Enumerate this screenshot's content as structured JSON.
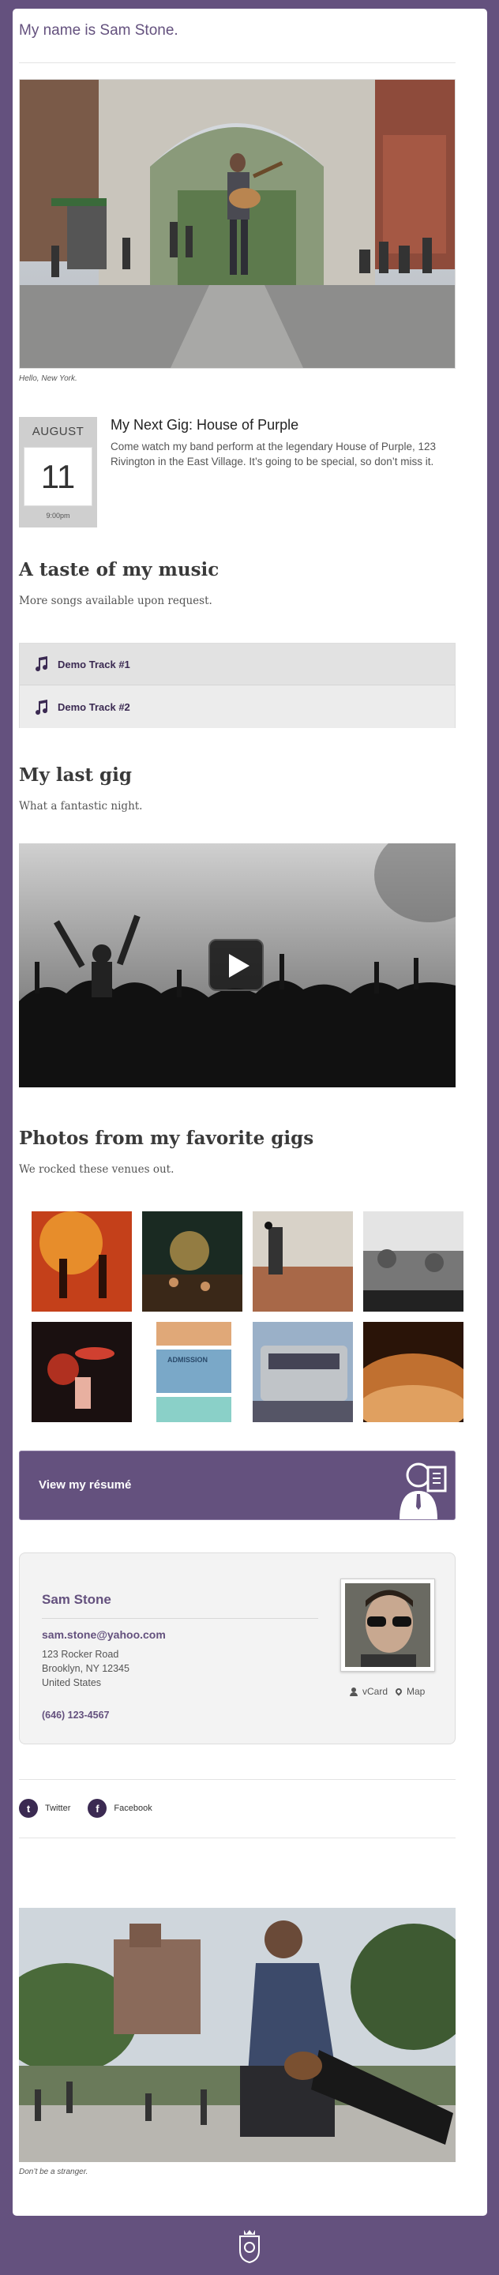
{
  "site_title": "My name is Sam Stone.",
  "hero_caption": "Hello, New York.",
  "gig": {
    "month": "AUGUST",
    "day": "11",
    "time": "9:00pm",
    "title": "My Next Gig: House of Purple",
    "description": "Come watch my band perform at the legendary House of Purple, 123 Rivington in the East Village. It’s going to be special, so don’t miss it."
  },
  "music": {
    "heading": "A taste of my music",
    "lede": "More songs available upon request.",
    "tracks": [
      {
        "label": "Demo Track #1",
        "icon": "music-note-icon"
      },
      {
        "label": "Demo Track #2",
        "icon": "music-note-icon"
      }
    ]
  },
  "last_gig": {
    "heading": "My last gig",
    "lede": "What a fantastic night."
  },
  "photos": {
    "heading": "Photos from my favorite gigs",
    "lede": "We rocked these venues out.",
    "ticket_text": "ADMISSION"
  },
  "resume": {
    "label": "View my résumé",
    "icon": "resume-person-icon"
  },
  "vcard": {
    "name": "Sam Stone",
    "email": "sam.stone@yahoo.com",
    "address_lines": [
      "123 Rocker Road",
      "Brooklyn, NY 12345",
      "United States"
    ],
    "phone": "(646) 123-4567",
    "vcard_label": "vCard",
    "map_label": "Map"
  },
  "social": [
    {
      "label": "Twitter",
      "icon": "twitter-icon"
    },
    {
      "label": "Facebook",
      "icon": "facebook-icon"
    }
  ],
  "bottom_caption": "Don’t be a stranger.",
  "colors": {
    "brand": "#64517e",
    "accent_dark": "#3b2a52",
    "card_bg": "#ffffff"
  }
}
